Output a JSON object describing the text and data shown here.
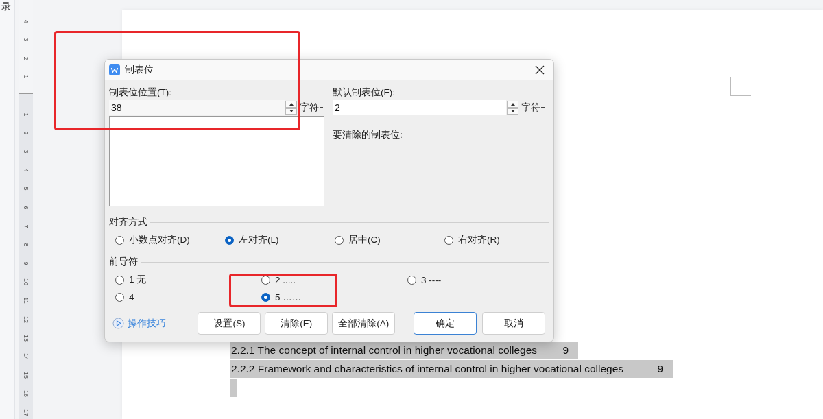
{
  "sidebar": {
    "label": "录"
  },
  "ruler": {
    "top_numbers": [
      "4",
      "3",
      "2",
      "1"
    ],
    "numbers": [
      "1",
      "2",
      "3",
      "4",
      "5",
      "6",
      "7",
      "8",
      "9",
      "10",
      "11",
      "12",
      "13",
      "14",
      "15",
      "16",
      "17"
    ]
  },
  "dialog": {
    "title": "制表位",
    "tab_position": {
      "label": "制表位位置(T):",
      "value": "38",
      "unit": "字符",
      "focused": false
    },
    "default_tab": {
      "label": "默认制表位(F):",
      "value": "2",
      "unit": "字符",
      "focused": true
    },
    "clear_label": "要清除的制表位:",
    "alignment": {
      "title": "对齐方式",
      "options": [
        {
          "label": "小数点对齐(D)",
          "selected": false
        },
        {
          "label": "左对齐(L)",
          "selected": true
        },
        {
          "label": "居中(C)",
          "selected": false
        },
        {
          "label": "右对齐(R)",
          "selected": false
        }
      ]
    },
    "leader": {
      "title": "前导符",
      "options": [
        {
          "label": "1 无",
          "selected": false
        },
        {
          "label": "2 .....",
          "selected": false
        },
        {
          "label": "3 ----",
          "selected": false
        },
        {
          "label": "4 ___",
          "selected": false
        },
        {
          "label": "5 ……",
          "selected": true
        }
      ]
    },
    "tips_link": "操作技巧",
    "buttons": [
      {
        "label": "设置(S)",
        "default": false
      },
      {
        "label": "清除(E)",
        "default": false
      },
      {
        "label": "全部清除(A)",
        "default": false
      },
      {
        "label": "确定",
        "default": true
      },
      {
        "label": "取消",
        "default": false
      }
    ]
  },
  "document": {
    "toc": [
      {
        "text": "2.2.1 The concept of internal control in higher vocational colleges",
        "page": "9"
      },
      {
        "text": "2.2.2 Framework and characteristics of internal control in higher vocational colleges",
        "page": "9"
      }
    ]
  },
  "annotations": [
    {
      "kind": "rectangle"
    },
    {
      "kind": "rectangle"
    }
  ]
}
